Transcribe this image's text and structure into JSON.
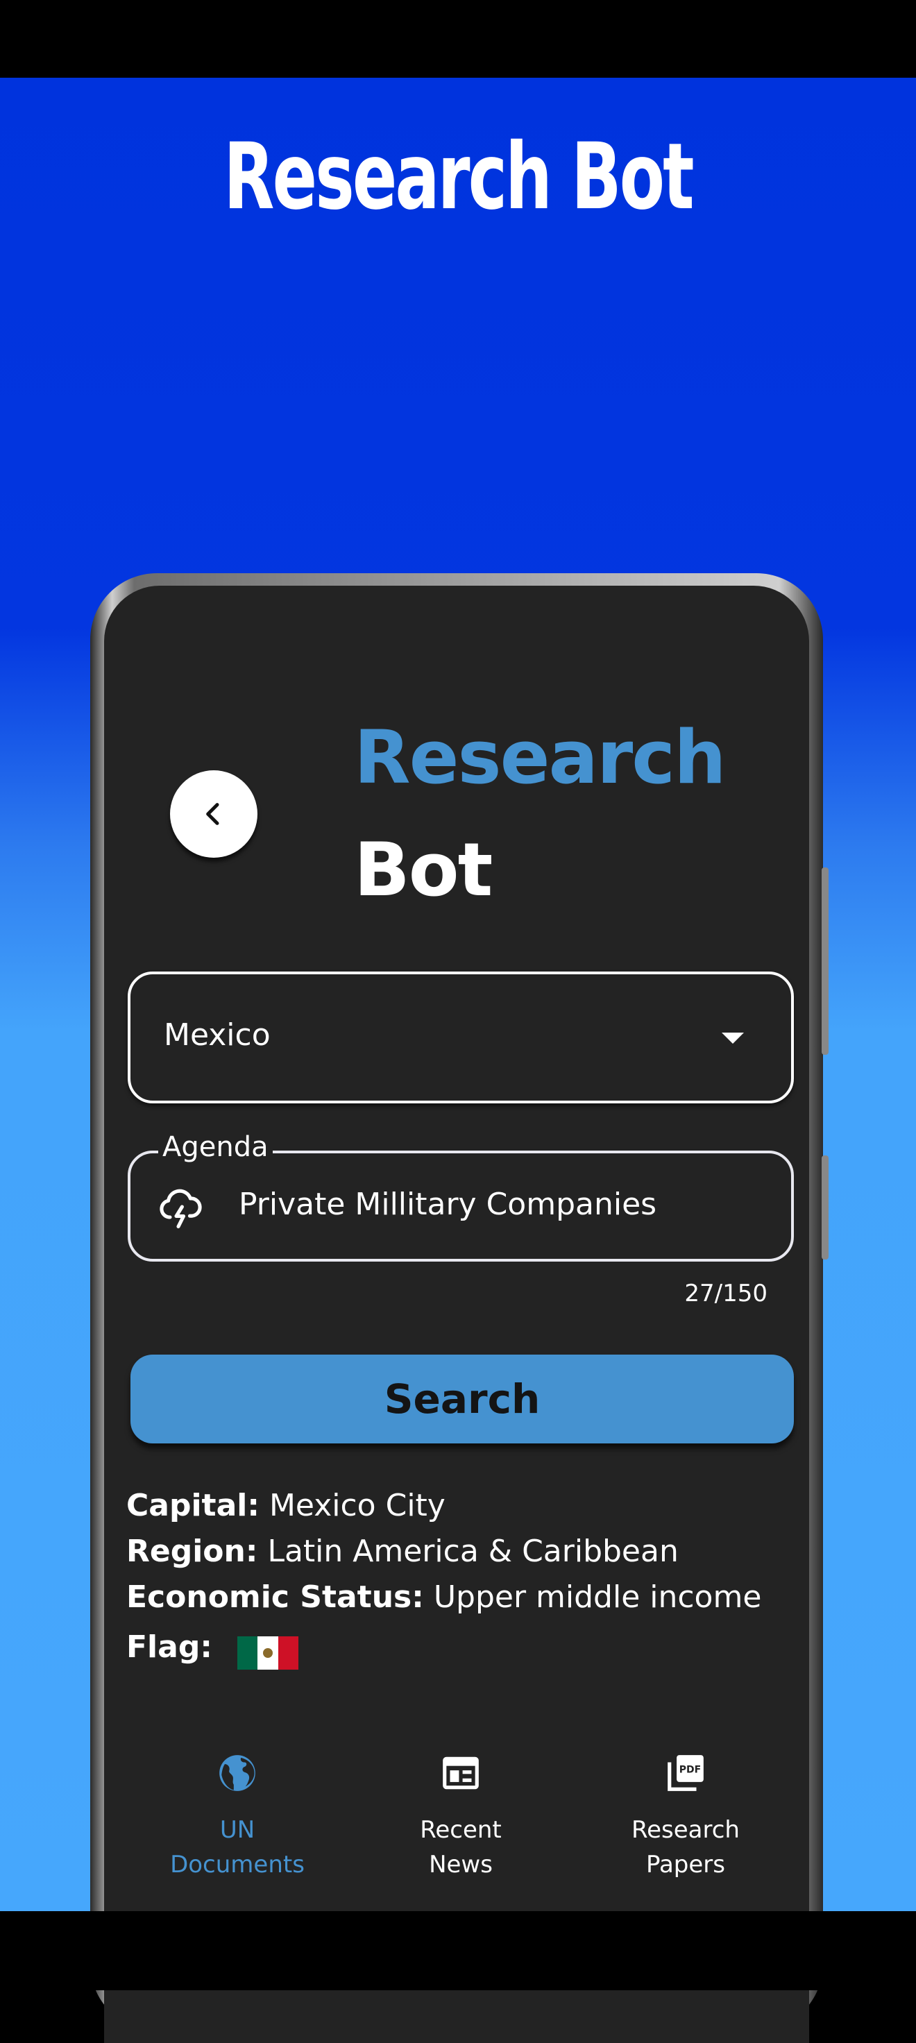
{
  "promo": {
    "title": "Research Bot"
  },
  "app": {
    "title_line1": "Research",
    "title_line2": "Bot"
  },
  "country_select": {
    "value": "Mexico"
  },
  "agenda": {
    "label": "Agenda",
    "value": "Private Millitary Companies",
    "counter": "27/150"
  },
  "search_button": {
    "label": "Search"
  },
  "country_info": {
    "capital_label": "Capital:",
    "capital": "Mexico City",
    "region_label": "Region:",
    "region": "Latin America & Caribbean",
    "economic_label": "Economic Status:",
    "economic": "Upper middle income",
    "flag_label": "Flag:"
  },
  "bottom_nav": {
    "items": [
      {
        "line1": "UN",
        "line2": "Documents",
        "icon": "globe-icon",
        "active": true
      },
      {
        "line1": "Recent",
        "line2": "News",
        "icon": "newspaper-icon",
        "active": false
      },
      {
        "line1": "Research",
        "line2": "Papers",
        "icon": "pdf-icon",
        "active": false
      }
    ]
  },
  "colors": {
    "accent": "#4592d0",
    "screen_bg": "#232323",
    "promo_blue": "#0033dd"
  }
}
